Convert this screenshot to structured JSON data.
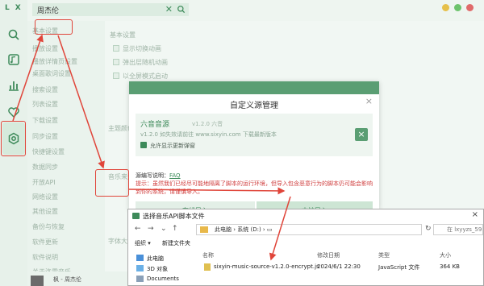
{
  "app": {
    "logo": "LX",
    "search_value": "周杰伦",
    "colors": {
      "accent": "#3d8a5a",
      "annotation": "#e0453a",
      "warning": "#d04040"
    }
  },
  "rail": {
    "items": [
      {
        "icon": "search-icon"
      },
      {
        "icon": "playlist-icon"
      },
      {
        "icon": "chart-icon"
      },
      {
        "icon": "heart-icon"
      },
      {
        "icon": "settings-icon",
        "active": true
      }
    ]
  },
  "settings_nav": {
    "items": [
      "基本设置",
      "播放设置",
      "播放详情页设置",
      "桌面歌词设置",
      "搜索设置",
      "列表设置",
      "下载设置",
      "同步设置",
      "快捷键设置",
      "数据同步",
      "开放API",
      "网络设置",
      "其他设置",
      "备份与恢复",
      "软件更新",
      "软件说明",
      "关于洛雪音乐"
    ]
  },
  "settings_main": {
    "section_title": "基本设置",
    "options": [
      "显示切换动画",
      "弹出层随机动画",
      "以全屏模式启动"
    ],
    "labels": [
      "主题颜色",
      "音乐来源",
      "字体大小"
    ]
  },
  "modal": {
    "title": "自定义源管理",
    "close": "×",
    "source": {
      "name": "六音音源",
      "version_badge": "v1.2.0 六音",
      "desc": "v1.2.0 如失效请前往 www.sixyin.com 下载最新版本",
      "allow_label": "允许显示更新弹窗",
      "delete": "×"
    },
    "faq_prefix": "源编写说明：",
    "faq_link": "FAQ",
    "tip": "提示：虽然我们已经尽可能地隔离了脚本的运行环境，但导入包含恶意行为的脚本仍可能会影响到你的系统，请谨慎导入。",
    "btn_online": "在线导入",
    "btn_local": "本地导入"
  },
  "file_dialog": {
    "title": "选择音乐API脚本文件",
    "close": "×",
    "address": [
      "此电脑",
      "系统 (D:)"
    ],
    "search_placeholder": "在 lxyyzs_5956...",
    "toolbar": {
      "organize": "组织 ▾",
      "new_folder": "新建文件夹"
    },
    "columns": {
      "name": "名称",
      "modified": "修改日期",
      "type": "类型",
      "size": "大小"
    },
    "tree": [
      "此电脑",
      "3D 对象",
      "Documents"
    ],
    "file": {
      "name": "sixyin-music-source-v1.2.0-encrypt.js",
      "modified": "2024/6/1 22:30",
      "type": "JavaScript 文件",
      "size": "364 KB"
    }
  },
  "player": {
    "song": "枫 - 周杰伦"
  }
}
